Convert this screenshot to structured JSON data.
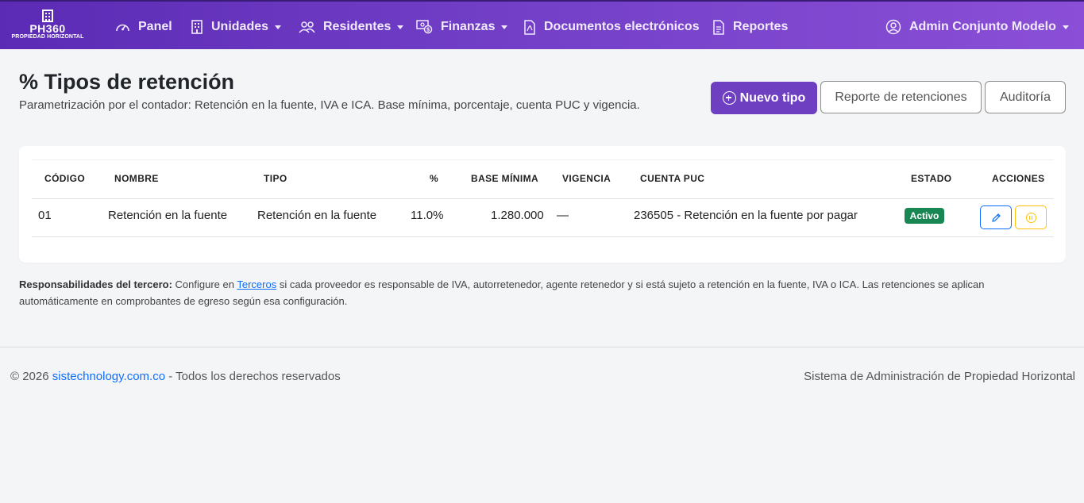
{
  "nav": {
    "brand_name": "PH360",
    "brand_sub": "PROPIEDAD HORIZONTAL",
    "items": [
      {
        "label": "Panel",
        "icon": "speedometer-icon",
        "dropdown": false
      },
      {
        "label": "Unidades",
        "icon": "building-icon",
        "dropdown": true
      },
      {
        "label": "Residentes",
        "icon": "people-icon",
        "dropdown": true
      },
      {
        "label": "Finanzas",
        "icon": "cash-coin-icon",
        "dropdown": true
      },
      {
        "label": "Documentos electrónicos",
        "icon": "file-pdf-icon",
        "dropdown": false
      },
      {
        "label": "Reportes",
        "icon": "file-text-icon",
        "dropdown": false
      }
    ],
    "user": {
      "label": "Admin Conjunto Modelo",
      "icon": "person-circle-icon",
      "dropdown": true
    }
  },
  "header": {
    "title": "% Tipos de retención",
    "subtitle": "Parametrización por el contador: Retención en la fuente, IVA e ICA. Base mínima, porcentaje, cuenta PUC y vigencia.",
    "new_button": "Nuevo tipo",
    "report_button": "Reporte de retenciones",
    "audit_button": "Auditoría"
  },
  "table": {
    "columns": [
      "CÓDIGO",
      "NOMBRE",
      "TIPO",
      "%",
      "BASE MÍNIMA",
      "VIGENCIA",
      "CUENTA PUC",
      "ESTADO",
      "ACCIONES"
    ],
    "rows": [
      {
        "codigo": "01",
        "nombre": "Retención en la fuente",
        "tipo": "Retención en la fuente",
        "porcentaje": "11.0%",
        "base_minima": "1.280.000",
        "vigencia": "—",
        "cuenta_puc": "236505 - Retención en la fuente por pagar",
        "estado": "Activo"
      }
    ]
  },
  "note": {
    "bold": "Responsabilidades del tercero:",
    "pre": " Configure en ",
    "link": "Terceros",
    "post": " si cada proveedor es responsable de IVA, autorretenedor, agente retenedor y si está sujeto a retención en la fuente, IVA o ICA. Las retenciones se aplican automáticamente en comprobantes de egreso según esa configuración."
  },
  "footer": {
    "copyright": "© 2026 ",
    "link": "sistechnology.com.co",
    "rights": " - Todos los derechos reservados",
    "right_text": "Sistema de Administración de Propiedad Horizontal"
  },
  "colors": {
    "navbar_start": "#5b2bb5",
    "navbar_end": "#8a4fd6",
    "primary": "#6f3fc1",
    "badge_success": "#198754",
    "edit_blue": "#0d6efd",
    "pause_yellow": "#ffc107"
  }
}
